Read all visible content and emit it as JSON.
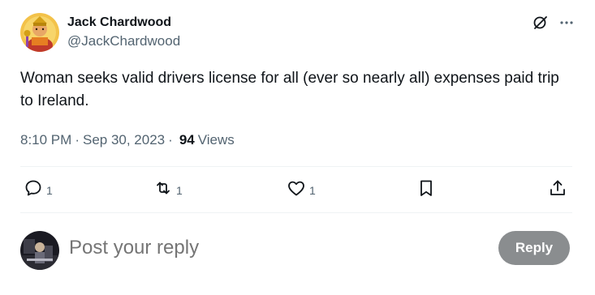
{
  "author": {
    "display_name": "Jack Chardwood",
    "handle": "@JackChardwood"
  },
  "tweet": {
    "text": "Woman seeks valid drivers license for all (ever so nearly all) expenses paid trip to Ireland.",
    "time": "8:10 PM",
    "date": "Sep 30, 2023",
    "separator": "·",
    "views_count": "94",
    "views_label": "Views"
  },
  "actions": {
    "replies": "1",
    "reposts": "1",
    "likes": "1"
  },
  "reply": {
    "placeholder": "Post your reply",
    "button_label": "Reply"
  },
  "icons": {
    "top": [
      "grok-icon",
      "more-icon"
    ],
    "actions": [
      "reply-icon",
      "repost-icon",
      "like-icon",
      "bookmark-icon",
      "share-icon"
    ]
  },
  "colors": {
    "text": "#0f1419",
    "secondary": "#536471",
    "divider": "#eff3f4",
    "reply_button": "#8a8d8f"
  }
}
